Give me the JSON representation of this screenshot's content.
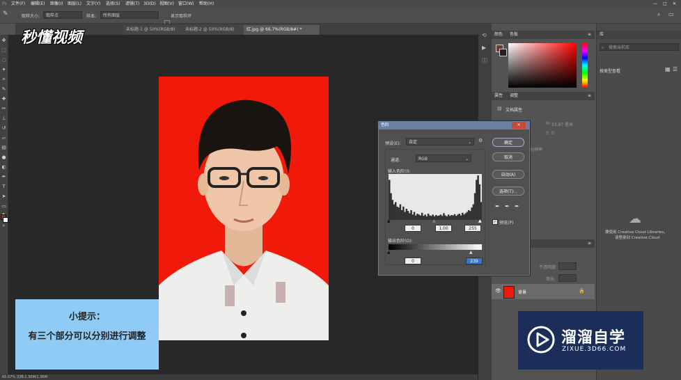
{
  "menu": [
    "文件(F)",
    "编辑(E)",
    "图像(I)",
    "图层(L)",
    "文字(Y)",
    "选择(S)",
    "滤镜(T)",
    "3D(D)",
    "视图(V)",
    "窗口(W)",
    "帮助(H)"
  ],
  "options": {
    "sample_size_label": "取样大小:",
    "sample_size_value": "取样点",
    "sample_label": "样本:",
    "sample_value": "所有图层",
    "show_ring": "显示取样环"
  },
  "tabs": [
    "未标题-1 @ 50%(RGB/8)",
    "未标题-2 @ 50%(RGB/8)",
    "红.jpg @ 66.7%(RGB/8#) *"
  ],
  "tab_close": "×",
  "watermark_top": "秒懂视频",
  "panels": {
    "color_tab": "颜色",
    "swatch_tab": "色板",
    "properties_tab": "属性",
    "adjust_tab": "调整",
    "doc_props": "文档属性",
    "w_label": "H:",
    "w_value": "33.87 厘米",
    "x_label": "Y:",
    "x_value": "0",
    "misc": "分辨率",
    "layer_name": "背景",
    "opacity_label": "不透明度:",
    "fill_label": "填充:"
  },
  "right": {
    "lib_tab": "库",
    "search_placeholder": "搜索当前库",
    "filter": "按类型查看",
    "cc_line1": "要使用 Creative Cloud Libraries，",
    "cc_line2": "请登录到 Creative Cloud"
  },
  "dialog": {
    "title": "色阶",
    "preset_label": "预设(E):",
    "preset_value": "自定",
    "channel_label": "通道:",
    "channel_value": "RGB",
    "input_label": "输入色阶(I):",
    "input_values": [
      "0",
      "1.00",
      "255"
    ],
    "output_label": "输出色阶(O):",
    "output_values": [
      "0",
      "239"
    ],
    "btn_ok": "确定",
    "btn_cancel": "取消",
    "btn_auto": "自动(A)",
    "btn_options": "选项(T)...",
    "preview_label": "预览(P)",
    "close": "×"
  },
  "tip": {
    "title": "小提示：",
    "body": "有三个部分可以分别进行调整"
  },
  "brand": {
    "name": "溜溜自学",
    "url": "ZIXUE.3D66.COM"
  },
  "status": "66.67%    文档:1.36M/1.36M",
  "colors": {
    "photo_bg": "#f11a0a",
    "tip_bg": "#8fcbf5",
    "brand_bg": "#1a2e59",
    "title_bar": "#6a7fa3"
  },
  "histogram": [
    90,
    60,
    45,
    35,
    40,
    30,
    28,
    35,
    22,
    30,
    18,
    25,
    20,
    15,
    22,
    12,
    18,
    10,
    14,
    12,
    10,
    16,
    9,
    12,
    8,
    14,
    10,
    9,
    12,
    8,
    11,
    9,
    10,
    12,
    9,
    15,
    10,
    8,
    12,
    9,
    11,
    10,
    13,
    9,
    12,
    14,
    10,
    16,
    12,
    15,
    18,
    22,
    20,
    28,
    35,
    60,
    90,
    100,
    80,
    40
  ]
}
